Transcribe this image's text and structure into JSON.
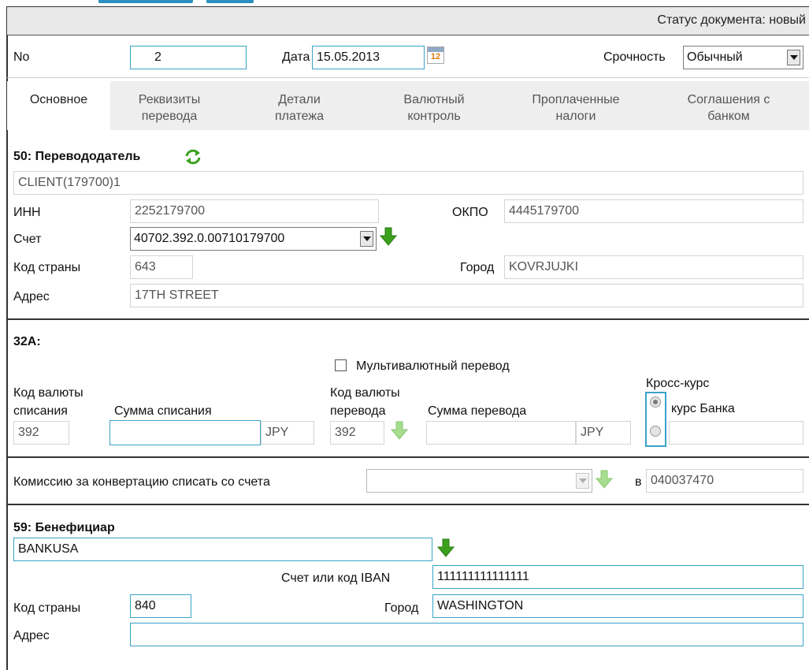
{
  "status": {
    "label": "Статус документа: новый"
  },
  "header": {
    "no_label": "No",
    "no_value": "2",
    "date_label": "Дата",
    "date_value": "15.05.2013",
    "calendar_day": "12",
    "urgency_label": "Срочность",
    "urgency_value": "Обычный"
  },
  "tabs": [
    {
      "label": "Основное"
    },
    {
      "label": "Реквизиты\nперевода"
    },
    {
      "label": "Детали\nплатежа"
    },
    {
      "label": "Валютный\nконтроль"
    },
    {
      "label": "Проплаченные\nналоги"
    },
    {
      "label": "Соглашения с\nбанком"
    }
  ],
  "remitter": {
    "title": "50: Перевододатель",
    "name": "CLIENT(179700)1",
    "inn_label": "ИНН",
    "inn_value": "2252179700",
    "okpo_label": "ОКПО",
    "okpo_value": "4445179700",
    "account_label": "Счет",
    "account_value": "40702.392.0.00710179700",
    "country_label": "Код страны",
    "country_value": "643",
    "city_label": "Город",
    "city_value": "KOVRJUJKI",
    "address_label": "Адрес",
    "address_value": "17TH STREET"
  },
  "amount": {
    "title": "32A:",
    "multicurrency_label": "Мультивалютный перевод",
    "debit_currency_label_1": "Код валюты",
    "debit_currency_label_2": "списания",
    "debit_currency_value": "392",
    "debit_amount_label": "Сумма списания",
    "debit_amount_value": "",
    "debit_amount_currency": "JPY",
    "transfer_currency_label_1": "Код валюты",
    "transfer_currency_label_2": "перевода",
    "transfer_currency_value": "392",
    "transfer_amount_label": "Сумма перевода",
    "transfer_amount_value": "",
    "transfer_amount_currency": "JPY",
    "cross_rate_label": "Кросс-курс",
    "bank_rate_label": "курс Банка",
    "custom_rate_value": ""
  },
  "commission": {
    "label": "Комиссию за конвертацию списать со счета",
    "account_value": "",
    "bic_label": "в",
    "bic_value": "040037470"
  },
  "beneficiary": {
    "title": "59: Бенефициар",
    "name": "BANKUSA",
    "account_label": "Счет или код IBAN",
    "account_value": "111111111111111",
    "country_label": "Код страны",
    "country_value": "840",
    "city_label": "Город",
    "city_value": "WASHINGTON",
    "address_label": "Адрес",
    "address_value": ""
  },
  "colors": {
    "field_border_editable": "#39a3c7",
    "tabs_background": "#eeeeee",
    "arrow_green": "#3ba11d",
    "arrow_green_disabled": "#a6dd8e"
  }
}
